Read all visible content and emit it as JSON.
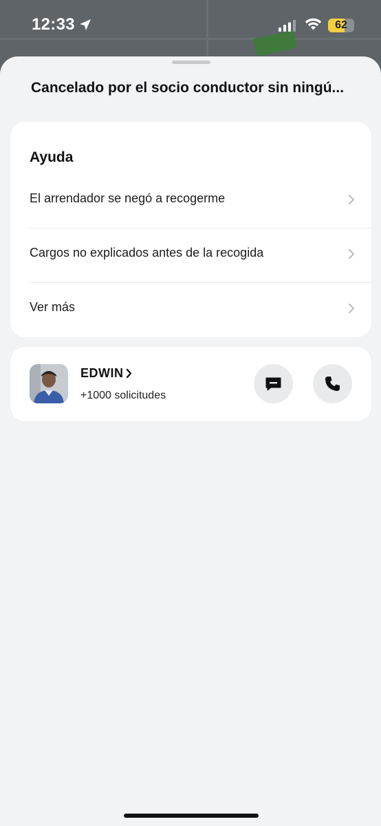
{
  "status_bar": {
    "time": "12:33",
    "battery_level": "62",
    "battery_fraction": 0.62
  },
  "sheet": {
    "title": "Cancelado por el socio conductor sin ningú..."
  },
  "help": {
    "heading": "Ayuda",
    "items": [
      {
        "label": "El arrendador se negó a recogerme"
      },
      {
        "label": "Cargos no explicados antes de la recogida"
      },
      {
        "label": "Ver más"
      }
    ]
  },
  "driver": {
    "name": "EDWIN",
    "trips": "+1000 solicitudes"
  },
  "icons": {
    "location": "location-arrow-icon",
    "signal": "cellular-signal-icon",
    "wifi": "wifi-icon",
    "battery": "battery-icon",
    "chevron": "chevron-right-icon",
    "message": "message-icon",
    "phone": "phone-icon"
  },
  "colors": {
    "sheet_background": "#f2f3f5",
    "card_background": "#ffffff",
    "button_background": "#e9eaec",
    "battery_accent": "#f4d03f"
  }
}
